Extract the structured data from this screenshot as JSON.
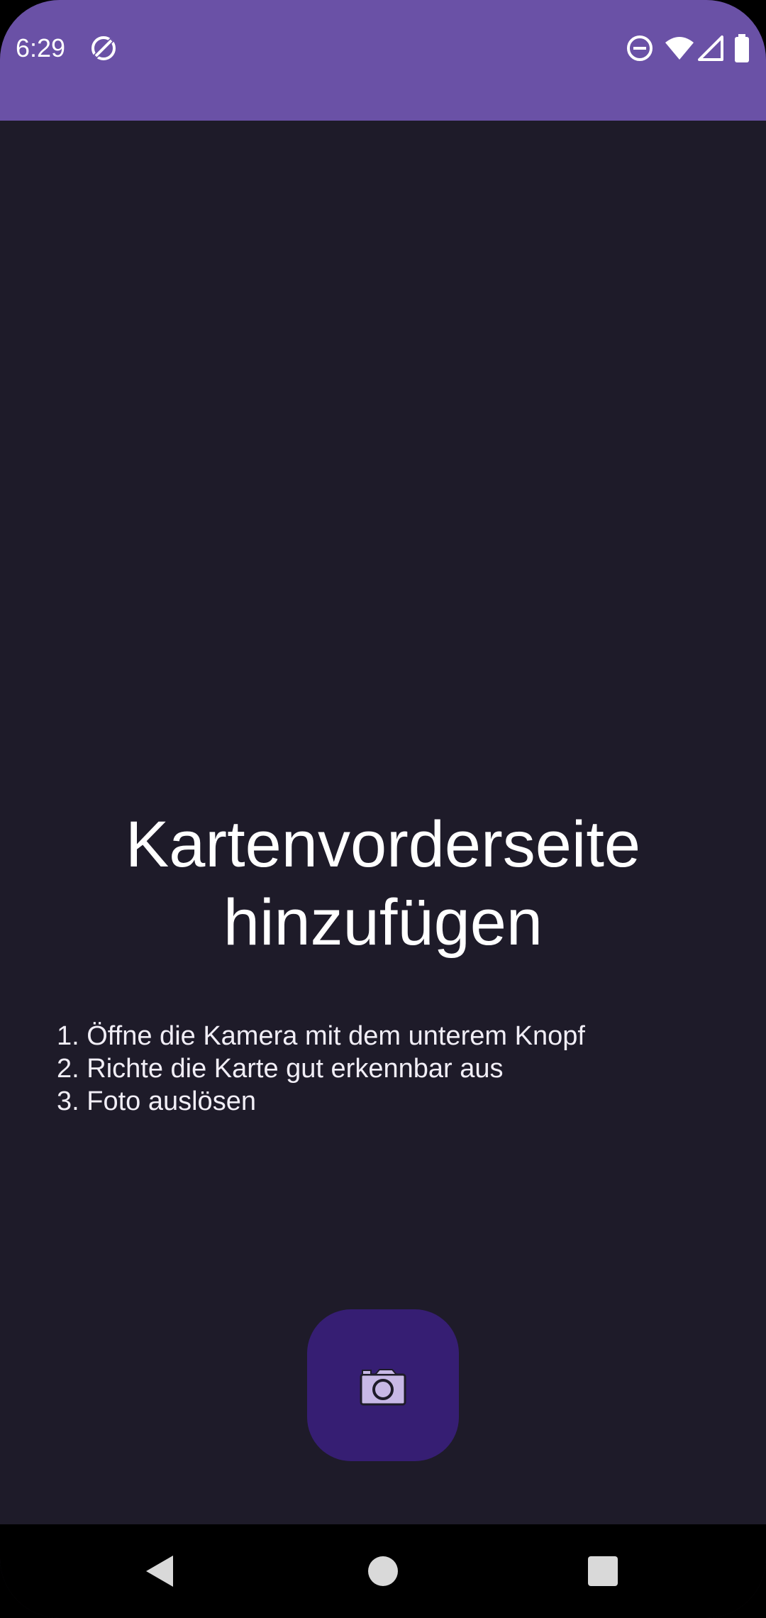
{
  "status_bar": {
    "time": "6:29",
    "icons": [
      "do-not-disturb-icon",
      "wifi-icon",
      "cell-signal-icon",
      "battery-icon",
      "sync-disabled-icon"
    ]
  },
  "screen": {
    "title": "Kartenvorderseite hinzufügen",
    "steps": [
      "1. Öffne die Kamera mit dem unterem Knopf",
      "2. Richte die Karte gut erkennbar aus",
      "3. Foto auslösen"
    ],
    "camera_button_icon": "camera-icon"
  },
  "navigation": {
    "back_icon": "back-icon",
    "home_icon": "home-icon",
    "recents_icon": "recents-icon"
  },
  "colors": {
    "status_bar": "#6a51a6",
    "background": "#1e1b29",
    "fab": "#361e73",
    "fab_icon": "#c8b8e6",
    "nav_bar": "#000000",
    "nav_icons": "#d9d9d9"
  }
}
